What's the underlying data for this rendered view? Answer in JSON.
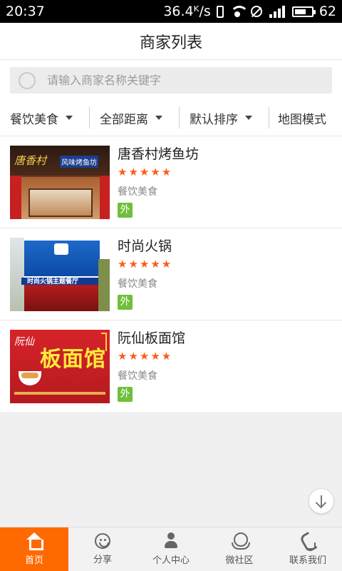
{
  "status_bar": {
    "time": "20:37",
    "network_speed": "36.4ᴷ/s",
    "battery": "62"
  },
  "header": {
    "title": "商家列表"
  },
  "search": {
    "placeholder": "请输入商家名称关键字"
  },
  "filters": [
    {
      "label": "餐饮美食"
    },
    {
      "label": "全部距离"
    },
    {
      "label": "默认排序"
    },
    {
      "label": "地图模式"
    }
  ],
  "merchants": [
    {
      "name": "唐香村烤鱼坊",
      "stars": "★★★★★",
      "rating": 5,
      "category": "餐饮美食",
      "badge": "外",
      "image_text": {
        "brand": "唐香村",
        "sign": "风味烤鱼坊"
      }
    },
    {
      "name": "时尚火锅",
      "stars": "★★★★★",
      "rating": 5,
      "category": "餐饮美食",
      "badge": "外",
      "image_text": {
        "sign": "时尚火锅主题餐厅"
      }
    },
    {
      "name": "阮仙板面馆",
      "stars": "★★★★★",
      "rating": 5,
      "category": "餐饮美食",
      "badge": "外",
      "image_text": {
        "brand": "阮仙",
        "sign": "板面馆"
      }
    }
  ],
  "tabbar": [
    {
      "label": "首页",
      "icon": "home-icon",
      "active": true
    },
    {
      "label": "分享",
      "icon": "smiley-icon"
    },
    {
      "label": "个人中心",
      "icon": "user-icon"
    },
    {
      "label": "微社区",
      "icon": "community-icon"
    },
    {
      "label": "联系我们",
      "icon": "phone-icon"
    }
  ],
  "colors": {
    "accent": "#ff6a00",
    "star": "#ff5a1e",
    "badge": "#6fbf3a"
  }
}
